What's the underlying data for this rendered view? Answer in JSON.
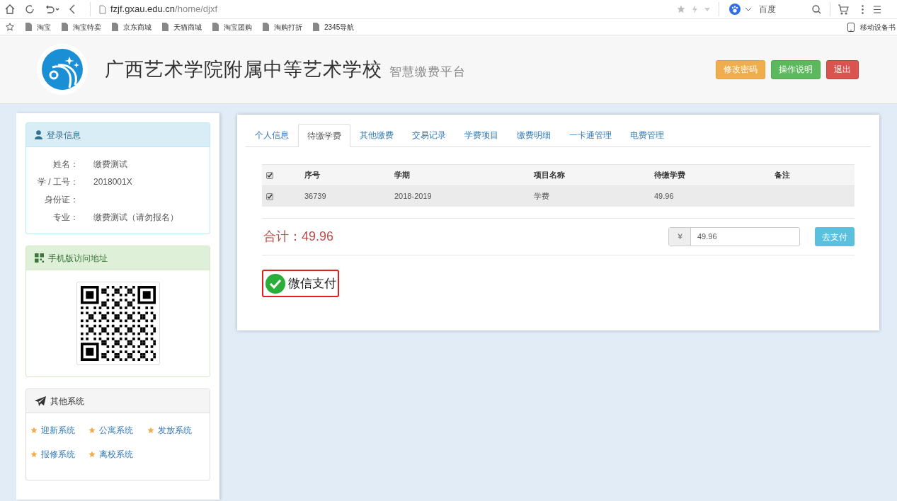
{
  "browser": {
    "url_host": "fzjf.gxau.edu.cn",
    "url_path": "/home/djxf",
    "search_engine": "百度",
    "bookmarks": [
      "淘宝",
      "淘宝特卖",
      "京东商城",
      "天猫商城",
      "淘宝团购",
      "淘购打折",
      "2345导航"
    ],
    "mobile_bookmarks": "移动设备书"
  },
  "header": {
    "title": "广西艺术学院附属中等艺术学校",
    "subtitle": "智慧缴费平台",
    "buttons": [
      {
        "label": "修改密码",
        "kind": "warning"
      },
      {
        "label": "操作说明",
        "kind": "success"
      },
      {
        "label": "退出",
        "kind": "danger"
      }
    ]
  },
  "login_info": {
    "title": "登录信息",
    "fields": [
      {
        "label": "姓名：",
        "value": "缴费测试"
      },
      {
        "label": "学 / 工号：",
        "value": "2018001X"
      },
      {
        "label": "身份证："
      },
      {
        "label": "专业：",
        "value": "缴费测试（请勿报名）"
      }
    ]
  },
  "mobile_access": {
    "title": "手机版访问地址"
  },
  "other_systems": {
    "title": "其他系统",
    "links": [
      "迎新系统",
      "公寓系统",
      "发放系统",
      "报修系统",
      "离校系统"
    ]
  },
  "tabs": [
    {
      "label": "个人信息",
      "selected": false
    },
    {
      "label": "待缴学费",
      "selected": true
    },
    {
      "label": "其他缴费",
      "selected": false
    },
    {
      "label": "交易记录",
      "selected": false
    },
    {
      "label": "学费项目",
      "selected": false
    },
    {
      "label": "缴费明细",
      "selected": false
    },
    {
      "label": "一卡通管理",
      "selected": false
    },
    {
      "label": "电费管理",
      "selected": false
    }
  ],
  "table": {
    "select_all": true,
    "columns": [
      "序号",
      "学期",
      "项目名称",
      "待缴学费",
      "备注"
    ],
    "rows": [
      {
        "checked": true,
        "cells": [
          "36739",
          "2018-2019",
          "学费",
          "49.96"
        ]
      }
    ]
  },
  "total": {
    "label": "合计：",
    "amount": "49.96"
  },
  "payment": {
    "currency": "￥",
    "amount": "49.96",
    "button": "去支付"
  },
  "wechat_pay": "微信支付"
}
